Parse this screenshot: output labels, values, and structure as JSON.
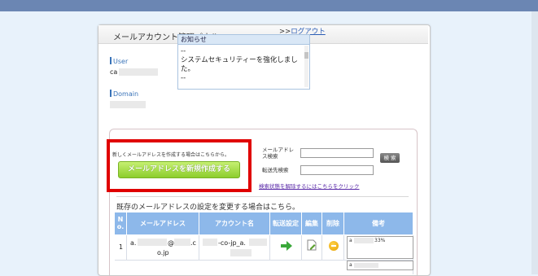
{
  "panel": {
    "title": "メールアカウント管理パネル"
  },
  "user": {
    "label": "User",
    "value": "ca"
  },
  "domain": {
    "label": "Domain"
  },
  "logout": {
    "prefix": ">>",
    "link": "ログアウト"
  },
  "notice": {
    "title": "お知らせ",
    "lines": [
      "--",
      "システムセキュリティーを強化しまし",
      "た。",
      "--"
    ]
  },
  "create": {
    "note": "新しくメールアドレスを作成する場合はこちらから。",
    "button": "メールアドレスを新規作成する"
  },
  "search": {
    "mail_label_1": "メールアドレ",
    "mail_label_2": "ス検索",
    "forward_label": "転送先検索",
    "button": "検 索",
    "clear_link": "検索状態を解除するにはこちらをクリック"
  },
  "existing": {
    "note": "既存のメールアドレスの設定を変更する場合はこちら。"
  },
  "table": {
    "headers": {
      "no_1": "N",
      "no_2": "o.",
      "mail": "メールアドレス",
      "account": "アカウント名",
      "forward": "転送設定",
      "edit": "編集",
      "delete": "削除",
      "memo": "備考"
    },
    "rows": [
      {
        "no": "1",
        "mail_1": "a.",
        "mail_2": "@",
        "mail_3": ".c",
        "mail_4": "o.jp",
        "account_1": "-co-jp_a.",
        "memo": "a",
        "memo_2": "33%"
      }
    ],
    "next_memo": "a"
  },
  "colors": {
    "topbar": "#6b86b3",
    "header": "#8db8ea",
    "accent_red": "#e00000",
    "button_green": "#8ccd2c"
  }
}
